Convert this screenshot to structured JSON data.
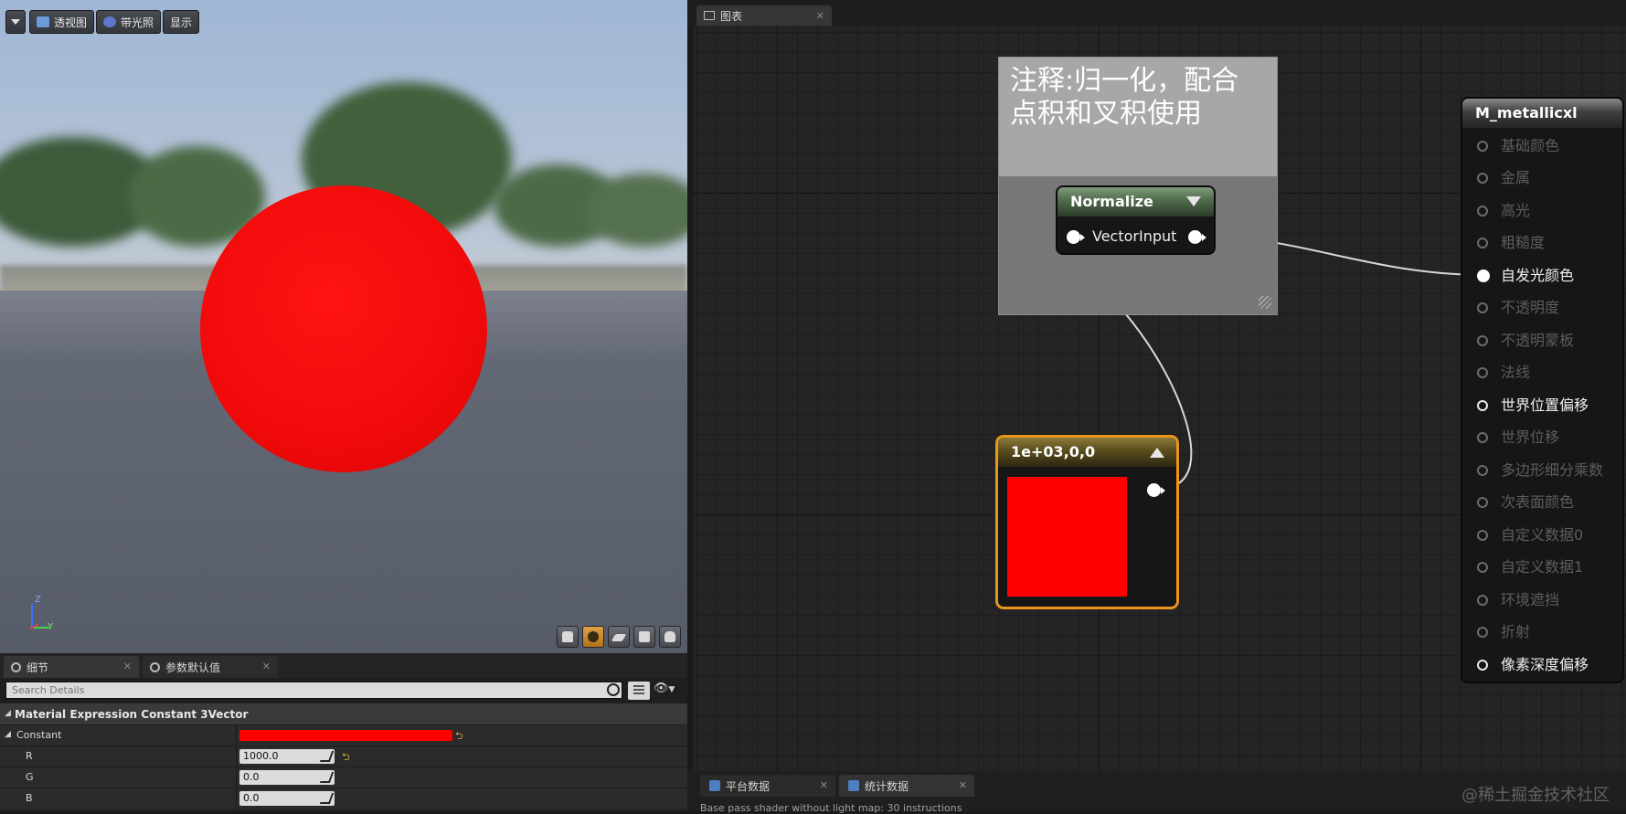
{
  "viewport": {
    "buttons": {
      "perspective": "透视图",
      "lit": "带光照",
      "show": "显示"
    },
    "axis": {
      "z": "Z",
      "y": "Y"
    }
  },
  "details": {
    "tabs": [
      {
        "label": "细节"
      },
      {
        "label": "参数默认值"
      }
    ],
    "search": {
      "placeholder": "Search Details"
    },
    "section_title": "Material Expression Constant 3Vector",
    "constant_label": "Constant",
    "constant_color": "#ff0000",
    "components": [
      {
        "label": "R",
        "value": "1000.0"
      },
      {
        "label": "G",
        "value": "0.0"
      },
      {
        "label": "B",
        "value": "0.0"
      }
    ]
  },
  "graph": {
    "tab_label": "图表",
    "comment": "注释:归一化，配合点积和叉积使用",
    "normalize_node": {
      "title": "Normalize",
      "input": "VectorInput"
    },
    "constant_node": {
      "title": "1e+03,0,0",
      "color": "#ff0000"
    },
    "material_node": {
      "title": "M_metallicxl",
      "pins": [
        {
          "label": "基础颜色",
          "active": false
        },
        {
          "label": "金属",
          "active": false
        },
        {
          "label": "高光",
          "active": false
        },
        {
          "label": "粗糙度",
          "active": false
        },
        {
          "label": "自发光颜色",
          "active": true,
          "connected": true
        },
        {
          "label": "不透明度",
          "active": false
        },
        {
          "label": "不透明蒙板",
          "active": false
        },
        {
          "label": "法线",
          "active": false
        },
        {
          "label": "世界位置偏移",
          "active": true
        },
        {
          "label": "世界位移",
          "active": false
        },
        {
          "label": "多边形细分乘数",
          "active": false
        },
        {
          "label": "次表面颜色",
          "active": false
        },
        {
          "label": "自定义数据0",
          "active": false
        },
        {
          "label": "自定义数据1",
          "active": false
        },
        {
          "label": "环境遮挡",
          "active": false
        },
        {
          "label": "折射",
          "active": false
        },
        {
          "label": "像素深度偏移",
          "active": true
        }
      ]
    }
  },
  "bottom": {
    "tabs": [
      {
        "label": "平台数据"
      },
      {
        "label": "统计数据"
      }
    ],
    "log": "Base pass shader without light map: 30 instructions",
    "watermark": "@稀土掘金技术社区"
  }
}
